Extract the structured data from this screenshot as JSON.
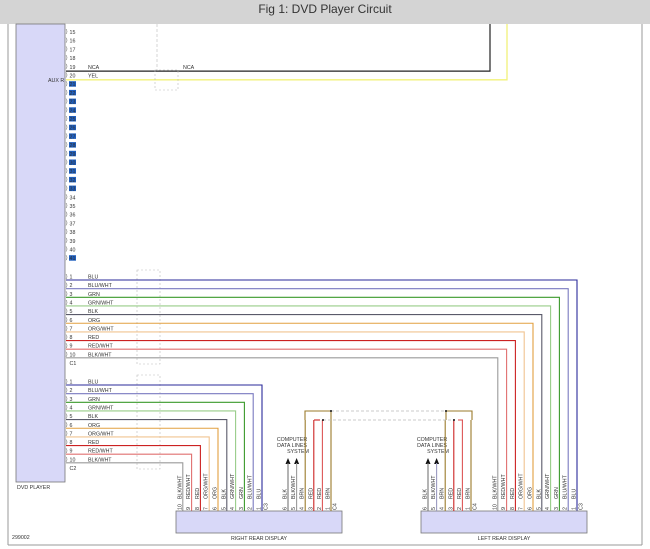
{
  "header": {
    "title": "Fig 1: DVD Player Circuit"
  },
  "diagram": {
    "figure_id": "299002",
    "dvd_player": {
      "label": "DVD PLAYER",
      "aux_label": "AUX R",
      "fill": "#d8d8f8"
    },
    "top_pins": [
      {
        "n": "15"
      },
      {
        "n": "16"
      },
      {
        "n": "17"
      },
      {
        "n": "18"
      },
      {
        "n": "19",
        "wire": "NCA",
        "wire2": "NCA",
        "color": "#222222"
      },
      {
        "n": "20",
        "wire": "YEL",
        "color": "#f2f27a"
      },
      {
        "n": "21",
        "hl": true
      },
      {
        "n": "22",
        "hl": true
      },
      {
        "n": "23",
        "hl": true
      },
      {
        "n": "24",
        "hl": true
      },
      {
        "n": "25",
        "hl": true
      },
      {
        "n": "26",
        "hl": true
      },
      {
        "n": "27",
        "hl": true
      },
      {
        "n": "28",
        "hl": true
      },
      {
        "n": "29",
        "hl": true
      },
      {
        "n": "30",
        "hl": true
      },
      {
        "n": "31",
        "hl": true
      },
      {
        "n": "32",
        "hl": true
      },
      {
        "n": "33",
        "hl": true
      },
      {
        "n": "34"
      },
      {
        "n": "35"
      },
      {
        "n": "36"
      },
      {
        "n": "37"
      },
      {
        "n": "38"
      },
      {
        "n": "39"
      },
      {
        "n": "40"
      },
      {
        "n": "41",
        "hl": true
      }
    ],
    "highlight_color": "#1f5fbf",
    "c1": {
      "label": "C1",
      "wires": [
        {
          "pin": "1",
          "name": "BLU",
          "color": "#2a2a9a"
        },
        {
          "pin": "2",
          "name": "BLU/WHT",
          "color": "#7a7ac0"
        },
        {
          "pin": "3",
          "name": "GRN",
          "color": "#3b9a2b"
        },
        {
          "pin": "4",
          "name": "GRN/WHT",
          "color": "#98cc88"
        },
        {
          "pin": "5",
          "name": "BLK",
          "color": "#5a5a6a"
        },
        {
          "pin": "6",
          "name": "ORG",
          "color": "#e2a040"
        },
        {
          "pin": "7",
          "name": "ORG/WHT",
          "color": "#f0c490"
        },
        {
          "pin": "8",
          "name": "RED",
          "color": "#cc2222"
        },
        {
          "pin": "9",
          "name": "RED/WHT",
          "color": "#e07070"
        },
        {
          "pin": "10",
          "name": "BLK/WHT",
          "color": "#9a9a9a"
        }
      ]
    },
    "c2": {
      "label": "C2",
      "wires": [
        {
          "pin": "1",
          "name": "BLU",
          "color": "#2a2a9a"
        },
        {
          "pin": "2",
          "name": "BLU/WHT",
          "color": "#7a7ac0"
        },
        {
          "pin": "3",
          "name": "GRN",
          "color": "#3b9a2b"
        },
        {
          "pin": "4",
          "name": "GRN/WHT",
          "color": "#98cc88"
        },
        {
          "pin": "5",
          "name": "BLK",
          "color": "#5a5a6a"
        },
        {
          "pin": "6",
          "name": "ORG",
          "color": "#e2a040"
        },
        {
          "pin": "7",
          "name": "ORG/WHT",
          "color": "#f0c490"
        },
        {
          "pin": "8",
          "name": "RED",
          "color": "#cc2222"
        },
        {
          "pin": "9",
          "name": "RED/WHT",
          "color": "#e07070"
        },
        {
          "pin": "10",
          "name": "BLK/WHT",
          "color": "#9a9a9a"
        }
      ]
    },
    "right_display": {
      "label": "RIGHT REAR DISPLAY",
      "c3_label": "C3",
      "c4_label": "C4",
      "data_lines": "COMPUTER|DATA LINES|SYSTEM",
      "c4_wires": [
        {
          "pin": "6",
          "name": "BLK",
          "color": "#777777"
        },
        {
          "pin": "5",
          "name": "BLK/WHT",
          "color": "#9a9a9a"
        },
        {
          "pin": "4",
          "name": "BRN",
          "color": "#9a7a2a"
        },
        {
          "pin": "3",
          "name": "RED",
          "color": "#cc2222"
        },
        {
          "pin": "2",
          "name": "RED",
          "color": "#dd5555"
        },
        {
          "pin": "1",
          "name": "BRN",
          "color": "#9a7a2a"
        }
      ]
    },
    "left_display": {
      "label": "LEFT REAR DISPLAY",
      "c3_label": "C3",
      "c4_label": "C4",
      "data_lines": "COMPUTER|DATA LINES|SYSTEM",
      "c4_wires": [
        {
          "pin": "6",
          "name": "BLK",
          "color": "#777777"
        },
        {
          "pin": "5",
          "name": "BLK/WHT",
          "color": "#9a9ac0"
        },
        {
          "pin": "4",
          "name": "BRN",
          "color": "#9a7a2a"
        },
        {
          "pin": "3",
          "name": "RED",
          "color": "#cc2222"
        },
        {
          "pin": "2",
          "name": "RED",
          "color": "#dd5555"
        },
        {
          "pin": "1",
          "name": "BRN",
          "color": "#9a7a2a"
        }
      ]
    }
  }
}
